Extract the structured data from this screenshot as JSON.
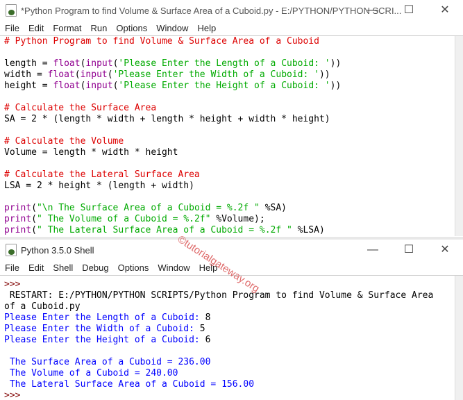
{
  "editor": {
    "title": "*Python Program to find Volume & Surface Area of a Cuboid.py - E:/PYTHON/PYTHON SCRI...",
    "menu": [
      "File",
      "Edit",
      "Format",
      "Run",
      "Options",
      "Window",
      "Help"
    ],
    "lines": [
      [
        {
          "t": "# Python Program to find Volume & Surface Area of a Cuboid",
          "c": "cmt"
        }
      ],
      [],
      [
        {
          "t": "length = ",
          "c": "txt"
        },
        {
          "t": "float",
          "c": "bi"
        },
        {
          "t": "(",
          "c": "txt"
        },
        {
          "t": "input",
          "c": "bi"
        },
        {
          "t": "(",
          "c": "txt"
        },
        {
          "t": "'Please Enter the Length of a Cuboid: '",
          "c": "str"
        },
        {
          "t": "))",
          "c": "txt"
        }
      ],
      [
        {
          "t": "width = ",
          "c": "txt"
        },
        {
          "t": "float",
          "c": "bi"
        },
        {
          "t": "(",
          "c": "txt"
        },
        {
          "t": "input",
          "c": "bi"
        },
        {
          "t": "(",
          "c": "txt"
        },
        {
          "t": "'Please Enter the Width of a Cuboid: '",
          "c": "str"
        },
        {
          "t": "))",
          "c": "txt"
        }
      ],
      [
        {
          "t": "height = ",
          "c": "txt"
        },
        {
          "t": "float",
          "c": "bi"
        },
        {
          "t": "(",
          "c": "txt"
        },
        {
          "t": "input",
          "c": "bi"
        },
        {
          "t": "(",
          "c": "txt"
        },
        {
          "t": "'Please Enter the Height of a Cuboid: '",
          "c": "str"
        },
        {
          "t": "))",
          "c": "txt"
        }
      ],
      [],
      [
        {
          "t": "# Calculate the Surface Area",
          "c": "cmt"
        }
      ],
      [
        {
          "t": "SA = 2 * (length * width + length * height + width * height)",
          "c": "txt"
        }
      ],
      [],
      [
        {
          "t": "# Calculate the Volume",
          "c": "cmt"
        }
      ],
      [
        {
          "t": "Volume = length * width * height",
          "c": "txt"
        }
      ],
      [],
      [
        {
          "t": "# Calculate the Lateral Surface Area",
          "c": "cmt"
        }
      ],
      [
        {
          "t": "LSA = 2 * height * (length + width)",
          "c": "txt"
        }
      ],
      [],
      [
        {
          "t": "print",
          "c": "bi"
        },
        {
          "t": "(",
          "c": "txt"
        },
        {
          "t": "\"\\n The Surface Area of a Cuboid = %.2f \"",
          "c": "str"
        },
        {
          "t": " %SA)",
          "c": "txt"
        }
      ],
      [
        {
          "t": "print",
          "c": "bi"
        },
        {
          "t": "(",
          "c": "txt"
        },
        {
          "t": "\" The Volume of a Cuboid = %.2f\"",
          "c": "str"
        },
        {
          "t": " %Volume);",
          "c": "txt"
        }
      ],
      [
        {
          "t": "print",
          "c": "bi"
        },
        {
          "t": "(",
          "c": "txt"
        },
        {
          "t": "\" The Lateral Surface Area of a Cuboid = %.2f \"",
          "c": "str"
        },
        {
          "t": " %LSA)",
          "c": "txt"
        }
      ]
    ]
  },
  "shell": {
    "title": "Python 3.5.0 Shell",
    "menu": [
      "File",
      "Edit",
      "Shell",
      "Debug",
      "Options",
      "Window",
      "Help"
    ],
    "lines": [
      [
        {
          "t": ">>>",
          "c": "pr"
        }
      ],
      [
        {
          "t": " RESTART: E:/PYTHON/PYTHON SCRIPTS/Python Program to find Volume & Surface Area",
          "c": "txt"
        }
      ],
      [
        {
          "t": "of a Cuboid.py",
          "c": "txt"
        }
      ],
      [
        {
          "t": "Please Enter the Length of a Cuboid: ",
          "c": "out"
        },
        {
          "t": "8",
          "c": "txt"
        }
      ],
      [
        {
          "t": "Please Enter the Width of a Cuboid: ",
          "c": "out"
        },
        {
          "t": "5",
          "c": "txt"
        }
      ],
      [
        {
          "t": "Please Enter the Height of a Cuboid: ",
          "c": "out"
        },
        {
          "t": "6",
          "c": "txt"
        }
      ],
      [],
      [
        {
          "t": " The Surface Area of a Cuboid = 236.00",
          "c": "out"
        }
      ],
      [
        {
          "t": " The Volume of a Cuboid = 240.00",
          "c": "out"
        }
      ],
      [
        {
          "t": " The Lateral Surface Area of a Cuboid = 156.00",
          "c": "out"
        }
      ],
      [
        {
          "t": ">>> ",
          "c": "pr"
        }
      ]
    ]
  },
  "watermark": "©tutorialgateway.org"
}
